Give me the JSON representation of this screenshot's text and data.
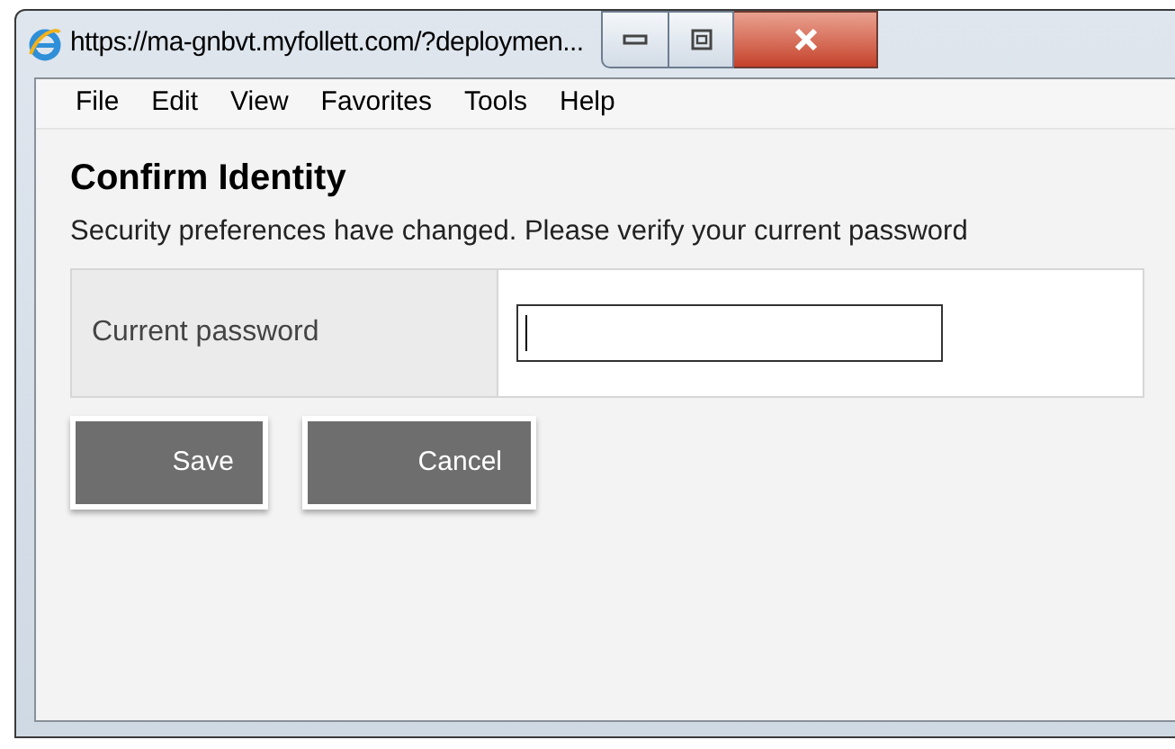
{
  "window": {
    "title": "https://ma-gnbvt.myfollett.com/?deploymen..."
  },
  "menu": [
    "File",
    "Edit",
    "View",
    "Favorites",
    "Tools",
    "Help"
  ],
  "dialog": {
    "heading": "Confirm Identity",
    "message": "Security preferences have changed. Please verify your current password",
    "fields": [
      {
        "label": "Current password",
        "focused": true
      }
    ],
    "buttons": [
      "Save",
      "Cancel"
    ]
  }
}
